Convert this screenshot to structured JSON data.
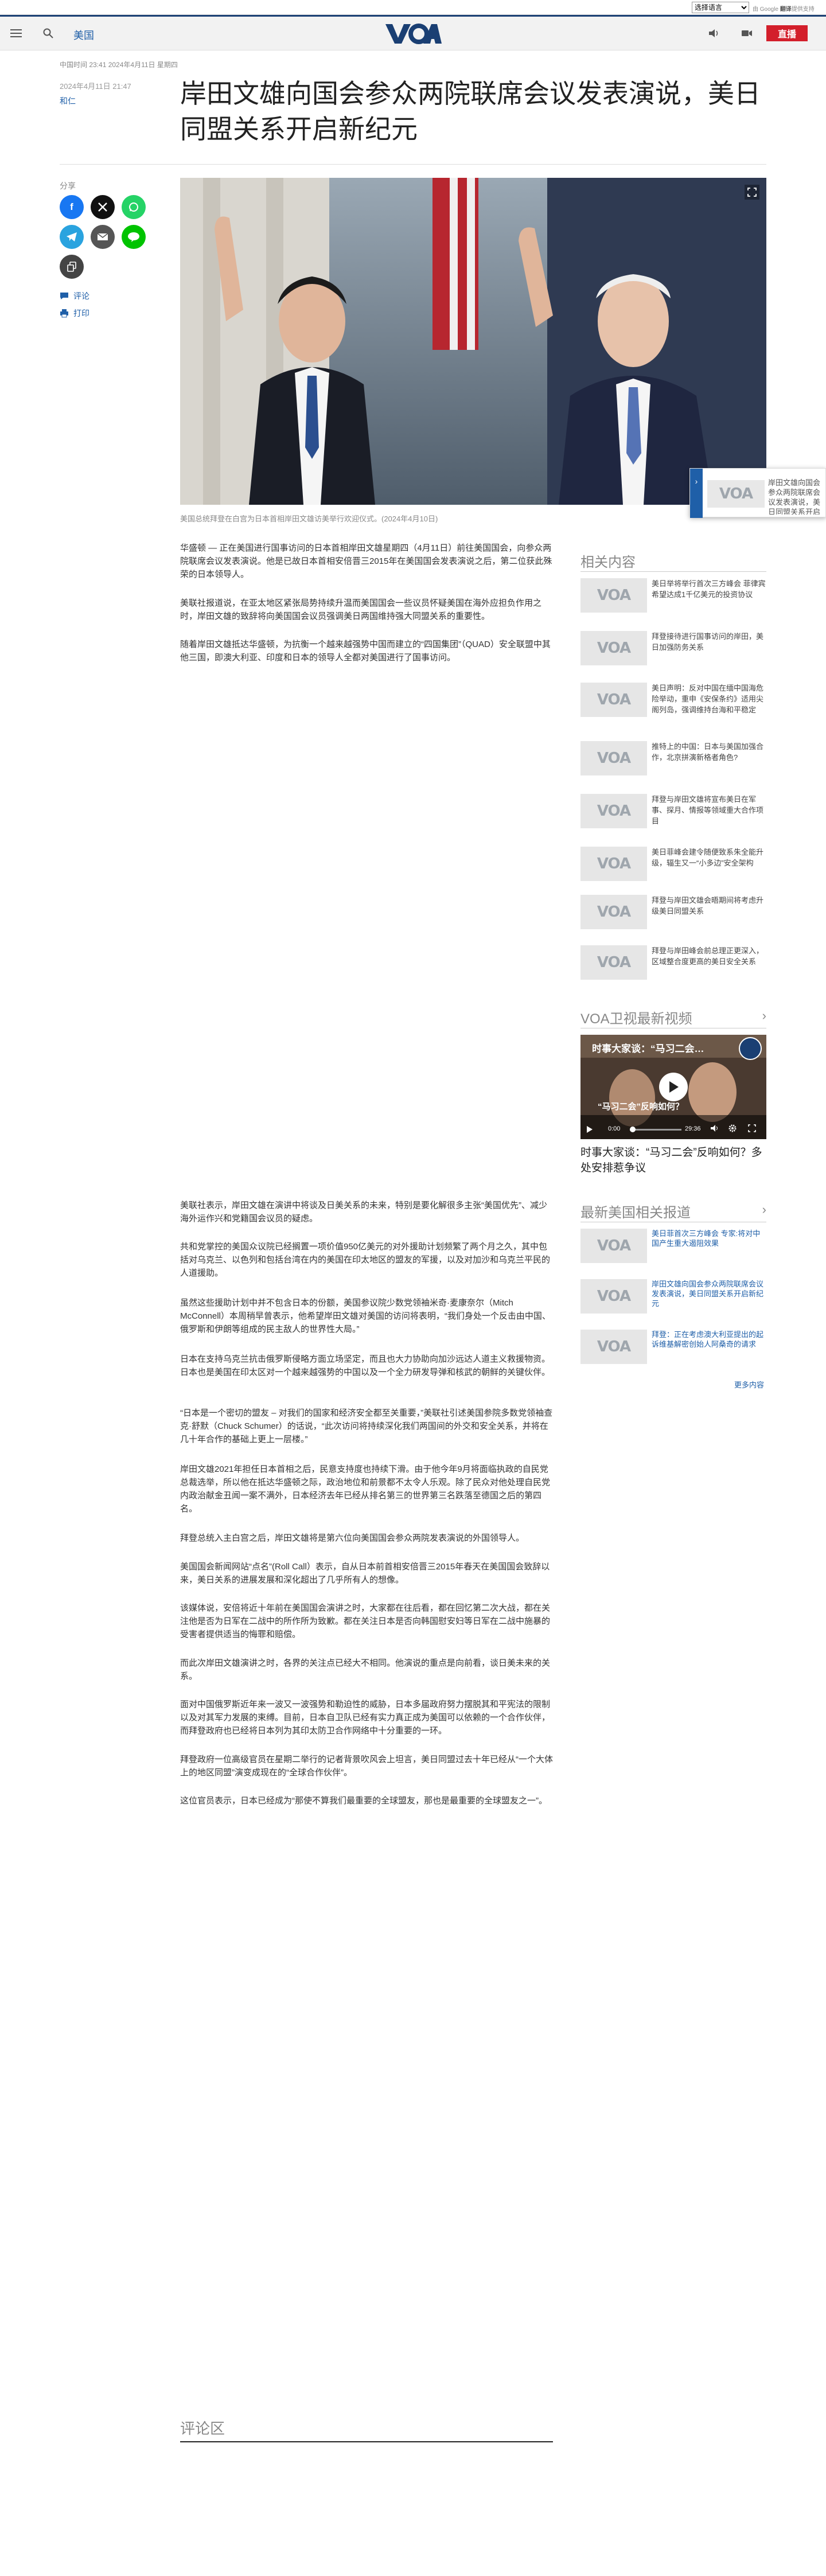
{
  "translate_bar": {
    "select_value": "选择语言",
    "powered_prefix": "由 Google",
    "powered_suffix": "提供支持",
    "powered_brand": "翻译"
  },
  "header": {
    "section": "美国",
    "logo_text": "VOA",
    "live_label": "直播",
    "accent": "#1a3f73",
    "live_color": "#d31f2b"
  },
  "meta": {
    "dates_top": "中国时间 23:41 2024年4月11日 星期四",
    "pub_date": "2024年4月11日 21:47",
    "author": "和仁",
    "title": "岸田文雄向国会参众两院联席会议发表演说，美日同盟关系开启新纪元"
  },
  "share": {
    "label": "分享",
    "buttons": [
      {
        "name": "facebook",
        "glyph": "f",
        "color": "#1877f2"
      },
      {
        "name": "x",
        "glyph": "𝕏",
        "color": "#111111"
      },
      {
        "name": "whatsapp",
        "glyph": "✆",
        "color": "#25d366"
      },
      {
        "name": "telegram",
        "glyph": "➤",
        "color": "#2aa3df"
      },
      {
        "name": "email",
        "glyph": "✉",
        "color": "#555555"
      },
      {
        "name": "line",
        "glyph": "L",
        "color": "#00c300"
      },
      {
        "name": "copy-link",
        "glyph": "⧉",
        "color": "#444444"
      }
    ],
    "comment_label": "评论",
    "print_label": "打印"
  },
  "hero": {
    "caption": "美国总统拜登在白宫为日本首相岸田文雄访美举行欢迎仪式。(2024年4月10日)"
  },
  "float_box": {
    "text": "岸田文雄向国会参众两院联席会议发表演说，美日同盟关系开启新纪元"
  },
  "article": {
    "paragraphs_a": [
      "华盛顿 — 正在美国进行国事访问的日本首相岸田文雄星期四（4月11日）前往美国国会，向参众两院联席会议发表演说。他是已故日本首相安倍晋三2015年在美国国会发表演说之后，第二位获此殊荣的日本领导人。",
      "美联社报道说，在亚太地区紧张局势持续升温而美国国会一些议员怀疑美国在海外应担负作用之时，岸田文雄的致辞将向美国国会议员强调美日两国维持强大同盟关系的重要性。",
      "随着岸田文雄抵达华盛顿，为抗衡一个越来越强势中国而建立的“四国集团”（QUAD）安全联盟中其他三国，即澳大利亚、印度和日本的领导人全都对美国进行了国事访问。"
    ],
    "paragraphs_b": [
      "美联社表示，岸田文雄在演讲中将谈及日美关系的未来，特别是要化解很多主张“美国优先”、减少海外运作兴和党籍国会议员的疑虑。",
      "共和党掌控的美国众议院已经搁置一项价值950亿美元的对外援助计划频繁了两个月之久，其中包括对乌克兰、以色列和包括台湾在内的美国在印太地区的盟友的军援，以及对加沙和乌克兰平民的人道援助。",
      "虽然这些援助计划中并不包含日本的份额，美国参议院少数党领袖米奇·麦康奈尔（Mitch McConnell）本周稍早曾表示，他希望岸田文雄对美国的访问将表明，“我们身处一个反击由中国、俄罗斯和伊朗等组成的民主敌人的世界性大局。”",
      "日本在支持乌克兰抗击俄罗斯侵略方面立场坚定，而且也大力协助向加沙远达人道主义救援物资。日本也是美国在印太区对一个越来越强势的中国以及一个全力研发导弹和核武的朝鲜的关键伙伴。",
      "“日本是一个密切的盟友 – 对我们的国家和经济安全都至关重要，”美联社引述美国参院多数党领袖查克·舒默（Chuck Schumer）的话说，“此次访问将持续深化我们两国间的外交和安全关系，并将在几十年合作的基础上更上一层楼。”",
      "岸田文雄2021年担任日本首相之后，民意支持度也持续下滑。由于他今年9月将面临执政的自民党总裁选举，所以他在抵达华盛顿之际，政治地位和前景都不太令人乐观。除了民众对他处理自民党内政治献金丑闻一案不满外，日本经济去年已经从排名第三的世界第三名跌落至德国之后的第四名。",
      "拜登总统入主白宫之后，岸田文雄将是第六位向美国国会参众两院发表演说的外国领导人。",
      "美国国会新闻网站“点名”(Roll Call）表示，自从日本前首相安倍晋三2015年春天在美国国会致辞以来，美日关系的进展发展和深化超出了几乎所有人的想像。",
      "该媒体说，安倍将近十年前在美国国会演讲之时，大家都在往后看，都在回忆第二次大战，都在关注他是否为日军在二战中的所作所为致歉。都在关注日本是否向韩国慰安妇等日军在二战中施暴的受害者提供适当的悔罪和赔偿。",
      "而此次岸田文雄演讲之时，各界的关注点已经大不相同。他演说的重点是向前看，谈日美未来的关系。",
      "面对中国俄罗斯近年来一波又一波强势和勒迫性的威胁，日本多届政府努力摆脱其和平宪法的限制以及对其军力发展的束缚。目前，日本自卫队已经有实力真正成为美国可以依赖的一个合作伙伴，而拜登政府也已经将日本列为其印太防卫合作网络中十分重要的一环。",
      "拜登政府一位高级官员在星期二举行的记者背景吹风会上坦言，美日同盟过去十年已经从“一个大体上的地区同盟”演变成现在的“全球合作伙伴”。",
      "这位官员表示，日本已经成为“那使不算我们最重要的全球盟友，那也是最重要的全球盟友之一”。"
    ],
    "comments_title": "评论区"
  },
  "related": {
    "title": "相关内容",
    "items": [
      "美日举将举行首次三方峰会 菲律宾希望达成1千亿美元的投资协议",
      "拜登接待进行国事访问的岸田，美日加强防务关系",
      "美日声明：反对中国在缅中国海危险举动，重申《安保条约》适用尖阁列岛，强调维持台海和平稳定",
      "推特上的中国：日本与美国加强合作，北京拼演新格者角色?",
      "拜登与岸田文雄将宣布美日在军事、探月、情报等领域重大合作项目",
      "美日菲峰会建令随便致系朱全能升级，辐生又一“小多边”安全架构",
      "拜登与岸田文雄会晤期间将考虑升级美日同盟关系",
      "拜登与岸田峰会前总理正更深入，区域整合度更高的美日安全关系"
    ]
  },
  "video": {
    "title": "VOA卫视最新视频",
    "overlay_title": "时事大家谈：“马习二会…",
    "big_text": "“马习二会”反响如何？",
    "time_current": "0:00",
    "time_total": "29:36",
    "caption": "时事大家谈：“马习二会”反响如何？多处安排惹争议"
  },
  "latest_news": {
    "title": "最新美国相关报道",
    "items": [
      "美日菲首次三方峰会 专家:将对中国产生重大遏阻效果",
      "岸田文雄向国会参众两院联席会议发表演说，美日同盟关系开启新纪元",
      "拜登：正在考虑澳大利亚提出的起诉维基解密创始人阿桑奇的请求"
    ],
    "more_label": "更多内容"
  }
}
